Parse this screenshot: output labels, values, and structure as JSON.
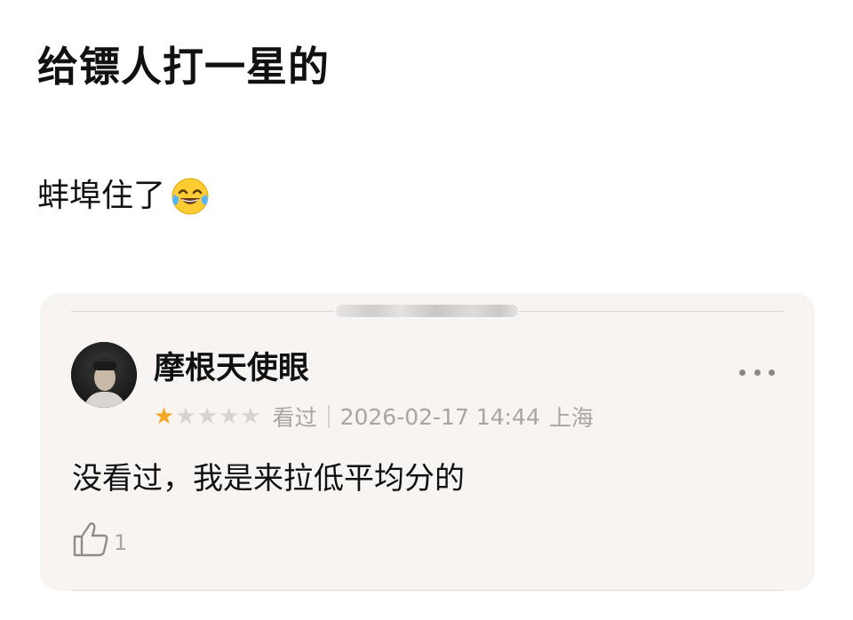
{
  "post": {
    "title": "给镖人打一星的",
    "body": "蚌埠住了",
    "emoji": "tears-of-joy-emoji"
  },
  "review": {
    "username": "摩根天使眼",
    "rating": 1,
    "max_rating": 5,
    "status": "看过",
    "datetime": "2026-02-17 14:44",
    "location": "上海",
    "text": "没看过，我是来拉低平均分的",
    "likes": "1",
    "icons": {
      "more": "more-horizontal-icon",
      "like": "thumbs-up-icon",
      "star_on": "star-filled-icon",
      "star_off": "star-empty-icon"
    }
  },
  "colors": {
    "card_bg": "#f7f4f2",
    "star_active": "#f5a623",
    "muted_text": "#a8a5a2"
  }
}
